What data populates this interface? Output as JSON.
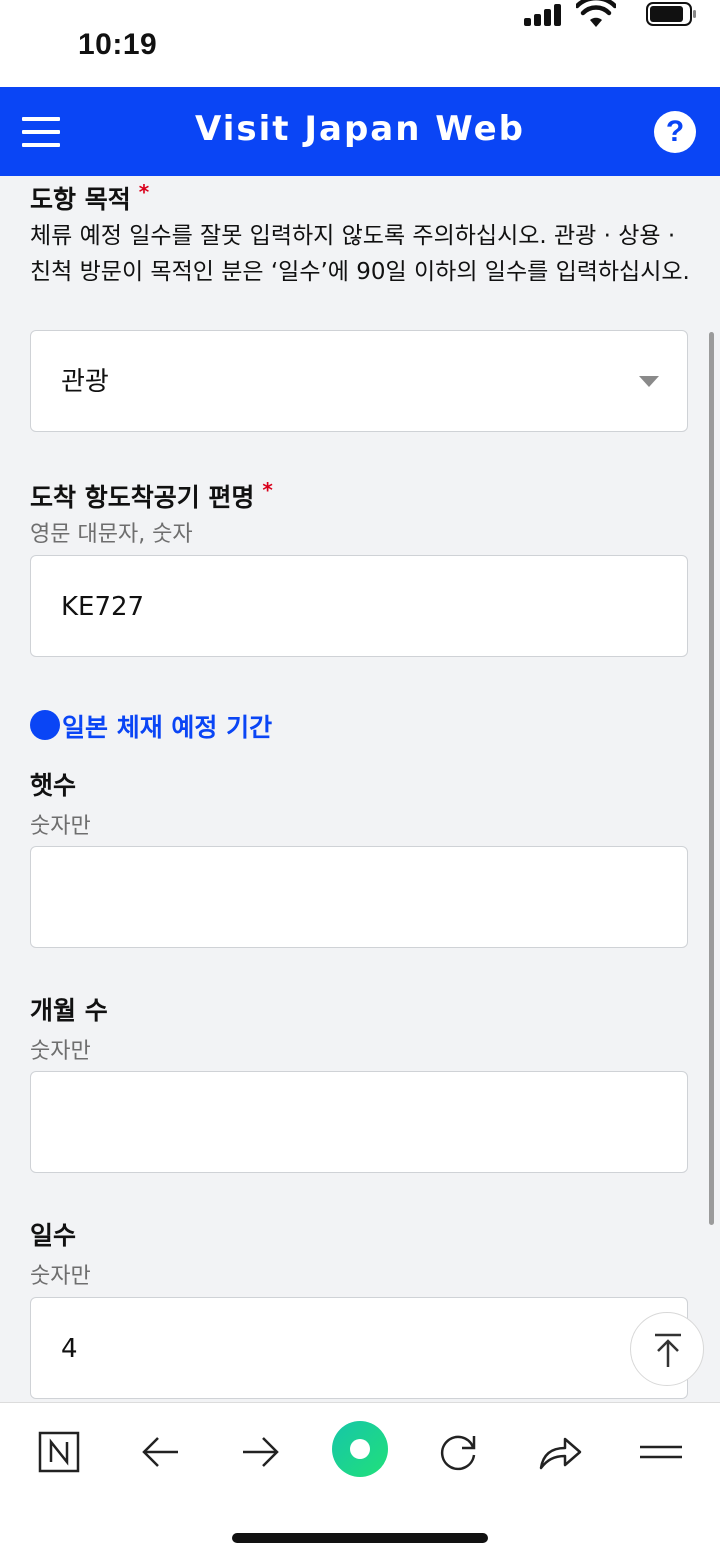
{
  "status_bar": {
    "time": "10:19"
  },
  "header": {
    "title": "Visit Japan Web"
  },
  "form": {
    "purpose": {
      "label": "도항 목적",
      "required_mark": "*",
      "description": "체류 예정 일수를 잘못 입력하지 않도록 주의하십시오. 관광 · 상용 · 친척 방문이 목적인 분은 ‘일수’에 90일 이하의 일수를 입력하십시오.",
      "selected": "관광"
    },
    "flight": {
      "label": "도착 항도착공기 편명",
      "required_mark": "*",
      "hint": "영문 대문자, 숫자",
      "value": "KE727"
    },
    "stay_period": {
      "heading": "일본 체재 예정 기간",
      "years": {
        "label": "햇수",
        "hint": "숫자만",
        "value": ""
      },
      "months": {
        "label": "개월 수",
        "hint": "숫자만",
        "value": ""
      },
      "days": {
        "label": "일수",
        "hint": "숫자만",
        "value": "4"
      }
    }
  },
  "bottom_nav": {
    "icons": [
      "naver-n-icon",
      "back-arrow-icon",
      "forward-arrow-icon",
      "green-dot-home-icon",
      "refresh-icon",
      "share-icon",
      "menu-lines-icon"
    ]
  },
  "colors": {
    "header_blue": "#0a45f5",
    "required_red": "#d9001b",
    "page_bg": "#f2f3f5",
    "green_button": "#19d68c"
  }
}
